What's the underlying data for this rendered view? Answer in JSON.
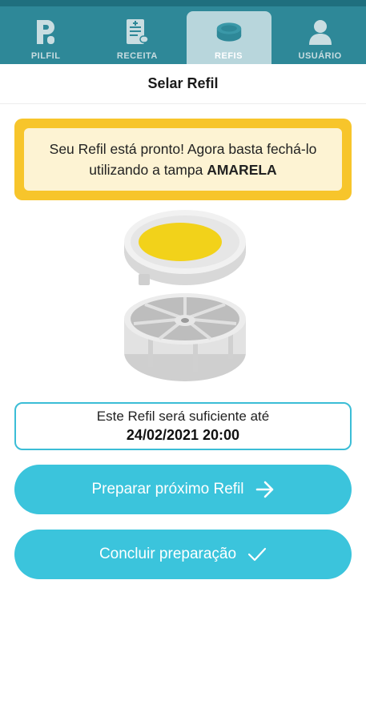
{
  "tabs": [
    {
      "label": "PILFIL",
      "icon": "pilfil-logo-icon",
      "active": false
    },
    {
      "label": "RECEITA",
      "icon": "prescription-icon",
      "active": false
    },
    {
      "label": "REFIS",
      "icon": "pill-case-icon",
      "active": true
    },
    {
      "label": "USUÁRIO",
      "icon": "user-icon",
      "active": false
    }
  ],
  "header": {
    "title": "Selar Refil"
  },
  "notice": {
    "text": "Seu Refil está pronto! Agora basta fechá-lo utilizando a tampa ",
    "highlight": "AMARELA"
  },
  "until": {
    "label": "Este Refil será suficiente até",
    "date": "24/02/2021 20:00"
  },
  "buttons": {
    "next_label": "Preparar próximo Refil",
    "done_label": "Concluir preparação"
  },
  "colors": {
    "topbar": "#2e8898",
    "accent": "#3bc4dc",
    "notice_border": "#f7c52b",
    "notice_bg": "#fdf3d3",
    "lid_yellow": "#f2d21a"
  }
}
